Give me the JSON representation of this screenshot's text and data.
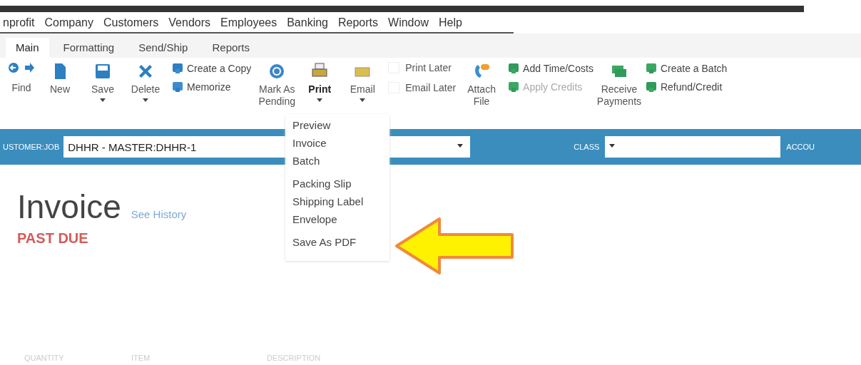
{
  "menu_bar": [
    "nprofit",
    "Company",
    "Customers",
    "Vendors",
    "Employees",
    "Banking",
    "Reports",
    "Window",
    "Help"
  ],
  "tabs": [
    {
      "label": "Main",
      "selected": true
    },
    {
      "label": "Formatting",
      "selected": false
    },
    {
      "label": "Send/Ship",
      "selected": false
    },
    {
      "label": "Reports",
      "selected": false
    }
  ],
  "toolbar": [
    {
      "kind": "nav",
      "label": "Find"
    },
    {
      "kind": "button",
      "label": "New",
      "caret": false,
      "expanded": false
    },
    {
      "kind": "button",
      "label": "Save",
      "caret": true,
      "expanded": false
    },
    {
      "kind": "button",
      "label": "Delete",
      "caret": true,
      "expanded": false
    },
    {
      "kind": "stack",
      "entries": [
        {
          "label": "Create a Copy",
          "disabled": false
        },
        {
          "label": "Memorize",
          "disabled": false
        }
      ]
    },
    {
      "kind": "button",
      "label": "Mark As Pending",
      "caret": false,
      "expanded": false
    },
    {
      "kind": "button",
      "label": "Print",
      "caret": true,
      "expanded": true
    },
    {
      "kind": "button",
      "label": "Email",
      "caret": true,
      "expanded": false
    },
    {
      "kind": "checks",
      "entries": [
        {
          "label": "Print Later",
          "checked": false
        },
        {
          "label": "Email Later",
          "checked": false
        }
      ]
    },
    {
      "kind": "button",
      "label": "Attach File",
      "caret": false,
      "expanded": false
    },
    {
      "kind": "stack",
      "entries": [
        {
          "label": "Add Time/Costs",
          "disabled": false
        },
        {
          "label": "Apply Credits",
          "disabled": true
        }
      ]
    },
    {
      "kind": "button",
      "label": "Receive Payments",
      "caret": false,
      "expanded": false
    },
    {
      "kind": "stack",
      "entries": [
        {
          "label": "Create a Batch",
          "disabled": false
        },
        {
          "label": "Refund/Credit",
          "disabled": false
        }
      ]
    }
  ],
  "print_menu": {
    "groups": [
      [
        "Preview",
        "Invoice",
        "Batch"
      ],
      [
        "Packing Slip",
        "Shipping Label",
        "Envelope"
      ],
      [
        "Save As PDF"
      ]
    ]
  },
  "header_bar": {
    "customer_job": {
      "label": "USTOMER:JOB",
      "value": "DHHR - MASTER:DHHR-1"
    },
    "class": {
      "label": "CLASS"
    },
    "cut_label": "ACCOU"
  },
  "invoice": {
    "title": "Invoice",
    "history_link": "See History",
    "status": "PAST DUE"
  },
  "columns": [
    "QUANTITY",
    "ITEM",
    "DESCRIPTION"
  ]
}
